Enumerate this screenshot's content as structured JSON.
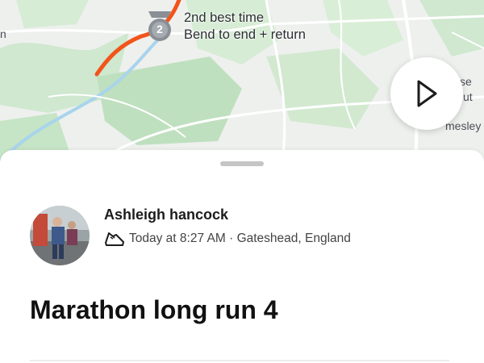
{
  "map": {
    "labels": {
      "left_edge": "n",
      "right_1": "se",
      "right_2": "ut",
      "right_3": "mesley"
    },
    "segment_badge_rank": "2",
    "segment_line1": "2nd best time",
    "segment_line2": "Bend to end + return",
    "route_color": "#f2541b"
  },
  "activity": {
    "athlete_name": "Ashleigh hancock",
    "time": "Today at 8:27 AM",
    "separator": " · ",
    "location": "Gateshead, England",
    "title": "Marathon long run 4",
    "sport_icon": "running-shoe-icon"
  }
}
